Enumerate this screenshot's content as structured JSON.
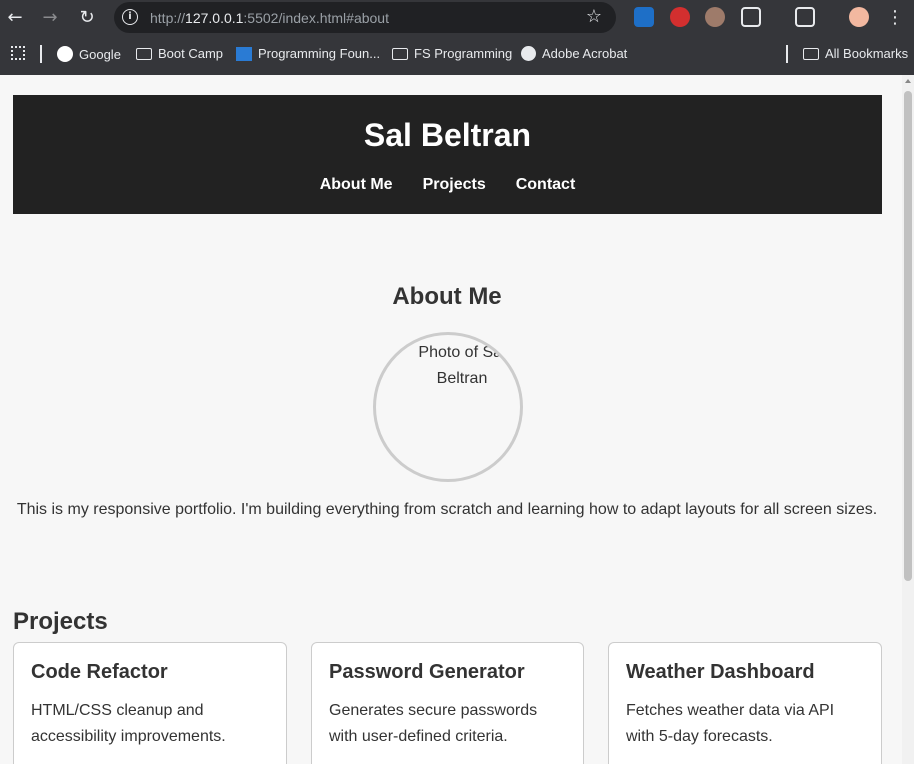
{
  "browser": {
    "url_prefix": "http://",
    "url_host": "127.0.0.1",
    "url_rest": ":5502/index.html#about",
    "bookmarks": [
      "Google",
      "Boot Camp",
      "Programming Foun...",
      "FS Programming",
      "Adobe Acrobat"
    ],
    "all_bookmarks": "All Bookmarks"
  },
  "site": {
    "title": "Sal Beltran",
    "nav": [
      "About Me",
      "Projects",
      "Contact"
    ]
  },
  "about": {
    "title": "About Me",
    "photo_alt": "Photo of Sal Beltran",
    "text": "This is my responsive portfolio. I'm building everything from scratch and learning how to adapt layouts for all screen sizes."
  },
  "projects": {
    "title": "Projects",
    "items": [
      {
        "title": "Code Refactor",
        "description": "HTML/CSS cleanup and accessibility improvements."
      },
      {
        "title": "Password Generator",
        "description": "Generates secure passwords with user-defined criteria."
      },
      {
        "title": "Weather Dashboard",
        "description": "Fetches weather data via API with 5-day forecasts."
      }
    ]
  },
  "colors": {
    "header_bg": "#222222",
    "page_bg": "#f7f7f7",
    "chrome_bg": "#35363a"
  }
}
